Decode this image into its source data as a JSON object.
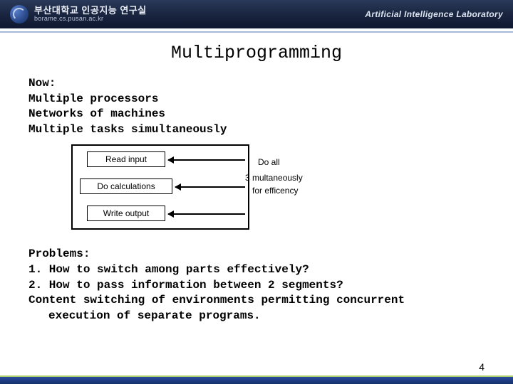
{
  "header": {
    "org_main": "부산대학교 인공지능 연구실",
    "org_sub": "borame.cs.pusan.ac.kr",
    "lab": "Artificial Intelligence Laboratory"
  },
  "slide": {
    "title": "Multiprogramming",
    "now_block": "Now:\nMultiple processors\nNetworks of machines\nMultiple tasks simultaneously",
    "diagram": {
      "box1": "Read input",
      "box2": "Do calculations",
      "box3": "Write output",
      "side_line1": "Do all",
      "side_line2": "3 multaneously",
      "side_line3": "for efficency"
    },
    "problems_l1": "Problems:",
    "problems_l2": "1. How to switch among parts effectively?",
    "problems_l3": "2. How to pass information between 2 segments?",
    "problems_l4a": "Content switching of environments permitting concurrent",
    "problems_l4b": "execution of separate programs."
  },
  "page_number": "4"
}
